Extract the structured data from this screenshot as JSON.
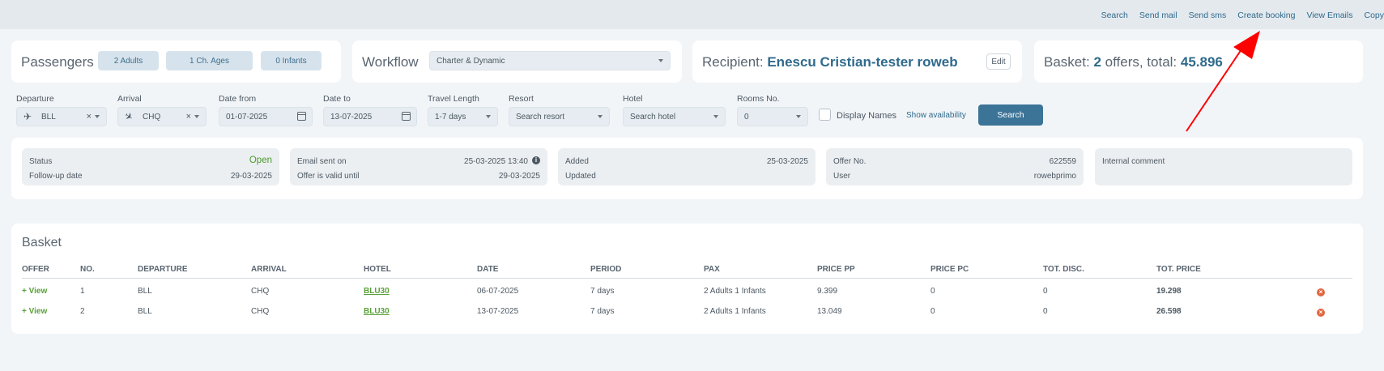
{
  "topnav": [
    "Search",
    "Send mail",
    "Send sms",
    "Create booking",
    "View Emails",
    "Copy"
  ],
  "passengers": {
    "title": "Passengers",
    "adults": "2 Adults",
    "children": "1 Ch. Ages",
    "infants": "0 Infants"
  },
  "workflow": {
    "title": "Workflow",
    "value": "Charter & Dynamic"
  },
  "recipient": {
    "label": "Recipient:",
    "name": "Enescu Cristian-tester roweb",
    "edit": "Edit"
  },
  "basket_summary": {
    "label": "Basket:",
    "count": "2",
    "mid": "offers, total:",
    "total": "45.896"
  },
  "search": {
    "departure_label": "Departure",
    "departure_value": "BLL",
    "arrival_label": "Arrival",
    "arrival_value": "CHQ",
    "date_from_label": "Date from",
    "date_from_value": "01-07-2025",
    "date_to_label": "Date to",
    "date_to_value": "13-07-2025",
    "travel_length_label": "Travel Length",
    "travel_length_value": "1-7 days",
    "resort_label": "Resort",
    "resort_placeholder": "Search resort",
    "hotel_label": "Hotel",
    "hotel_placeholder": "Search hotel",
    "rooms_label": "Rooms No.",
    "rooms_value": "0",
    "display_names": "Display Names",
    "show_availability": "Show availability",
    "search_button": "Search"
  },
  "status_info": {
    "status_label": "Status",
    "status_value": "Open",
    "followup_label": "Follow-up date",
    "followup_value": "29-03-2025",
    "email_sent_label": "Email sent on",
    "email_sent_value": "25-03-2025 13:40",
    "valid_until_label": "Offer is valid until",
    "valid_until_value": "29-03-2025",
    "added_label": "Added",
    "added_value": "25-03-2025",
    "updated_label": "Updated",
    "offer_no_label": "Offer No.",
    "offer_no_value": "622559",
    "user_label": "User",
    "user_value": "rowebprimo",
    "internal_comment_label": "Internal comment"
  },
  "basket": {
    "title": "Basket",
    "headers": [
      "OFFER",
      "NO.",
      "DEPARTURE",
      "ARRIVAL",
      "HOTEL",
      "DATE",
      "PERIOD",
      "PAX",
      "PRICE PP",
      "PRICE PC",
      "TOT. DISC.",
      "TOT. PRICE"
    ],
    "rows": [
      {
        "offer": "+ View",
        "no": "1",
        "departure": "BLL",
        "arrival": "CHQ",
        "hotel": "BLU30",
        "date": "06-07-2025",
        "period": "7 days",
        "pax": "2 Adults 1 Infants",
        "price_pp": "9.399",
        "price_pc": "0",
        "tot_disc": "0",
        "tot_price": "19.298"
      },
      {
        "offer": "+ View",
        "no": "2",
        "departure": "BLL",
        "arrival": "CHQ",
        "hotel": "BLU30",
        "date": "13-07-2025",
        "period": "7 days",
        "pax": "2 Adults 1 Infants",
        "price_pp": "13.049",
        "price_pc": "0",
        "tot_disc": "0",
        "tot_price": "26.598"
      }
    ]
  },
  "colors": {
    "accent": "#3c7497",
    "link": "#2f6a8c",
    "status_open": "#4a9a2a",
    "view_green": "#5aa13a",
    "remove": "#e0673f",
    "arrow": "#ff0000"
  }
}
